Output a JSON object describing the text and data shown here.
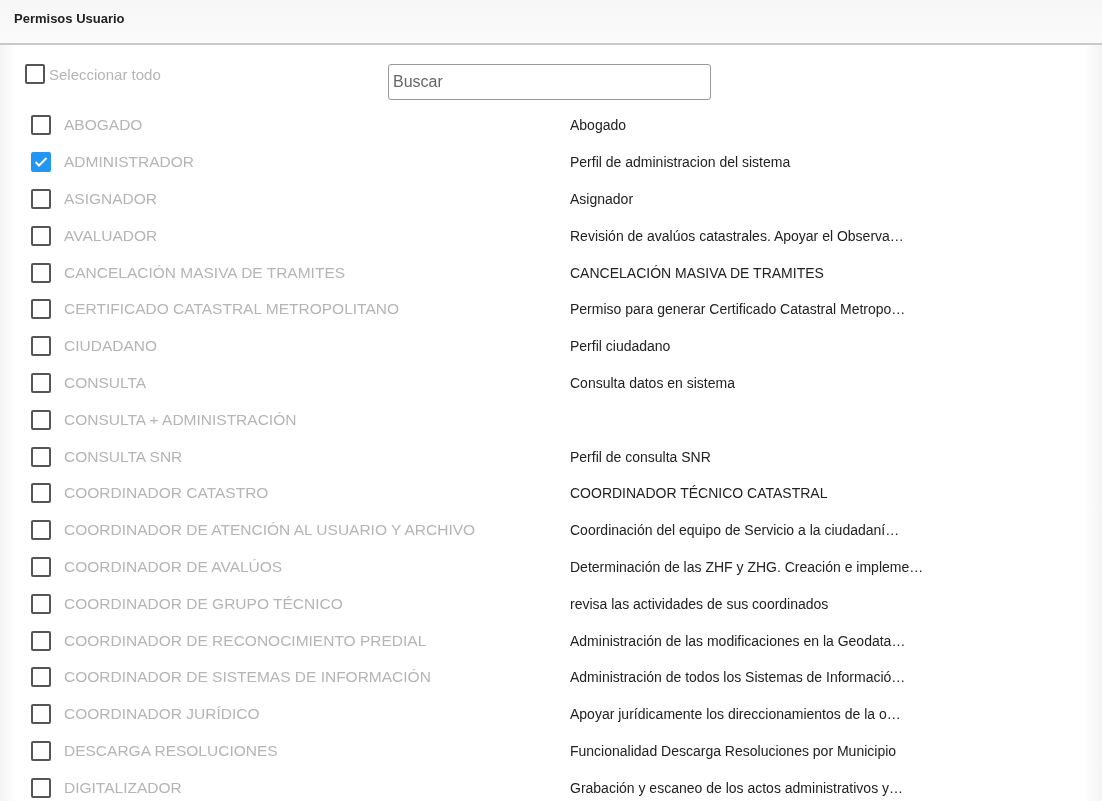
{
  "header": {
    "title": "Permisos Usuario"
  },
  "select_all": {
    "label": "Seleccionar todo",
    "checked": false
  },
  "search": {
    "placeholder": "Buscar"
  },
  "permissions": [
    {
      "label": "ABOGADO",
      "description": "Abogado",
      "checked": false
    },
    {
      "label": "ADMINISTRADOR",
      "description": "Perfil de administracion del sistema",
      "checked": true
    },
    {
      "label": "ASIGNADOR",
      "description": "Asignador",
      "checked": false
    },
    {
      "label": "AVALUADOR",
      "description": "Revisión de avalúos catastrales. Apoyar el Observa…",
      "checked": false
    },
    {
      "label": "CANCELACIÓN MASIVA DE TRAMITES",
      "description": "CANCELACIÓN MASIVA DE TRAMITES",
      "checked": false
    },
    {
      "label": "CERTIFICADO CATASTRAL METROPOLITANO",
      "description": "Permiso para generar Certificado Catastral Metropo…",
      "checked": false
    },
    {
      "label": "CIUDADANO",
      "description": "Perfil ciudadano",
      "checked": false
    },
    {
      "label": "CONSULTA",
      "description": "Consulta datos en sistema",
      "checked": false
    },
    {
      "label": "CONSULTA + ADMINISTRACIÓN",
      "checked": false
    },
    {
      "label": "CONSULTA SNR",
      "description": "Perfil de consulta SNR",
      "checked": false
    },
    {
      "label": "COORDINADOR CATASTRO",
      "description": "COORDINADOR TÉCNICO CATASTRAL",
      "checked": false
    },
    {
      "label": "COORDINADOR DE ATENCIÓN AL USUARIO Y ARCHIVO",
      "description": "Coordinación del equipo de Servicio a la ciudadaní…",
      "checked": false
    },
    {
      "label": "COORDINADOR DE AVALÚOS",
      "description": "Determinación de las ZHF y ZHG. Creación e impleme…",
      "checked": false
    },
    {
      "label": "COORDINADOR DE GRUPO TÉCNICO",
      "description": "revisa las actividades de sus coordinados",
      "checked": false
    },
    {
      "label": "COORDINADOR DE RECONOCIMIENTO PREDIAL",
      "description": "Administración de las modificaciones en la Geodata…",
      "checked": false
    },
    {
      "label": "COORDINADOR DE SISTEMAS DE INFORMACIÓN",
      "description": "Administración de todos los Sistemas de Informació…",
      "checked": false
    },
    {
      "label": "COORDINADOR JURÍDICO",
      "description": "Apoyar jurídicamente los direccionamientos de la o…",
      "checked": false
    },
    {
      "label": "DESCARGA RESOLUCIONES",
      "description": "Funcionalidad Descarga Resoluciones por Municipio",
      "checked": false
    },
    {
      "label": "DIGITALIZADOR",
      "description": "Grabación y escaneo de los actos administrativos y…",
      "checked": false
    }
  ]
}
